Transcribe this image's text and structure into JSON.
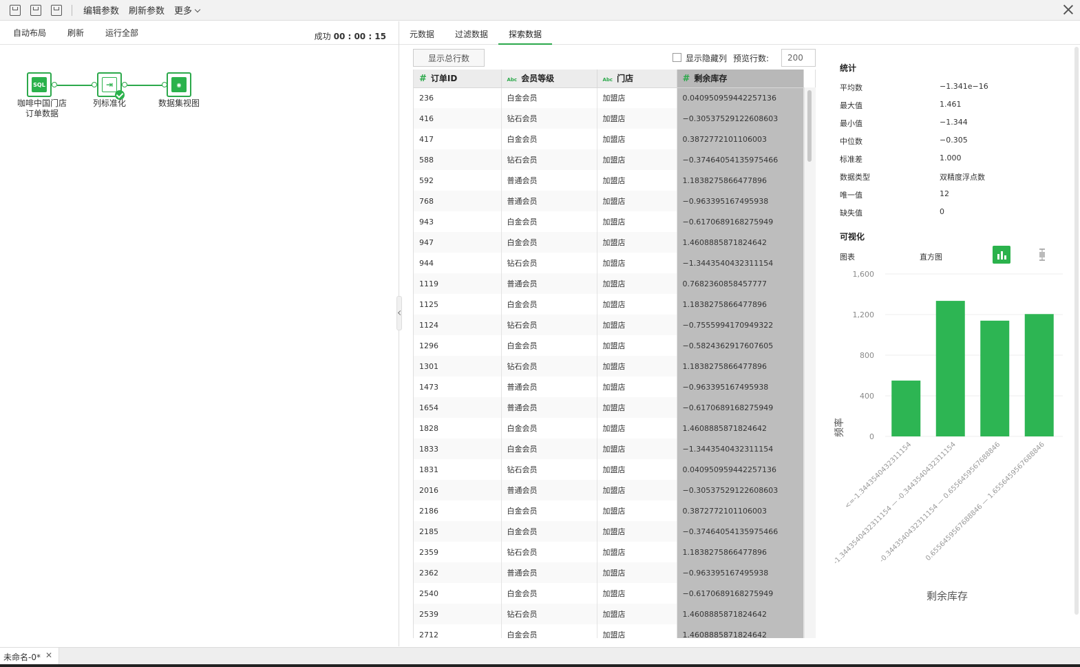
{
  "toolbar": {
    "edit_params": "编辑参数",
    "refresh_params": "刷新参数",
    "more": "更多"
  },
  "left_bar": {
    "auto_layout": "自动布局",
    "refresh": "刷新",
    "run_all": "运行全部",
    "status_label": "成功",
    "status_time": "00 : 00 : 15"
  },
  "flow": {
    "node1_icon": "SQL",
    "node1_line1": "咖啡中国门店",
    "node1_line2": "订单数据",
    "node2_label": "列标准化",
    "node3_label": "数据集视图"
  },
  "tabs": [
    "元数据",
    "过滤数据",
    "探索数据"
  ],
  "table_toolbar": {
    "show_total": "显示总行数",
    "show_hidden": "显示隐藏列",
    "preview_rows_label": "预览行数:",
    "preview_rows_value": "200"
  },
  "table": {
    "columns": [
      {
        "type": "#",
        "name": "订单ID"
      },
      {
        "type": "Abc",
        "name": "会员等级"
      },
      {
        "type": "Abc",
        "name": "门店"
      },
      {
        "type": "#",
        "name": "剩余库存"
      }
    ],
    "rows": [
      [
        "236",
        "白金会员",
        "加盟店",
        "0.040950959442257136"
      ],
      [
        "416",
        "钻石会员",
        "加盟店",
        "−0.30537529122608603"
      ],
      [
        "417",
        "白金会员",
        "加盟店",
        "0.3872772101106003"
      ],
      [
        "588",
        "钻石会员",
        "加盟店",
        "−0.37464054135975466"
      ],
      [
        "592",
        "普通会员",
        "加盟店",
        "1.1838275866477896"
      ],
      [
        "768",
        "普通会员",
        "加盟店",
        "−0.963395167495938"
      ],
      [
        "943",
        "白金会员",
        "加盟店",
        "−0.6170689168275949"
      ],
      [
        "947",
        "白金会员",
        "加盟店",
        "1.4608885871824642"
      ],
      [
        "944",
        "钻石会员",
        "加盟店",
        "−1.3443540432311154"
      ],
      [
        "1119",
        "普通会员",
        "加盟店",
        "0.7682360858457777"
      ],
      [
        "1125",
        "白金会员",
        "加盟店",
        "1.1838275866477896"
      ],
      [
        "1124",
        "钻石会员",
        "加盟店",
        "−0.7555994170949322"
      ],
      [
        "1296",
        "白金会员",
        "加盟店",
        "−0.5824362917607605"
      ],
      [
        "1301",
        "钻石会员",
        "加盟店",
        "1.1838275866477896"
      ],
      [
        "1473",
        "普通会员",
        "加盟店",
        "−0.963395167495938"
      ],
      [
        "1654",
        "普通会员",
        "加盟店",
        "−0.6170689168275949"
      ],
      [
        "1828",
        "白金会员",
        "加盟店",
        "1.4608885871824642"
      ],
      [
        "1833",
        "白金会员",
        "加盟店",
        "−1.3443540432311154"
      ],
      [
        "1831",
        "钻石会员",
        "加盟店",
        "0.040950959442257136"
      ],
      [
        "2016",
        "普通会员",
        "加盟店",
        "−0.30537529122608603"
      ],
      [
        "2186",
        "白金会员",
        "加盟店",
        "0.3872772101106003"
      ],
      [
        "2185",
        "白金会员",
        "加盟店",
        "−0.37464054135975466"
      ],
      [
        "2359",
        "钻石会员",
        "加盟店",
        "1.1838275866477896"
      ],
      [
        "2362",
        "普通会员",
        "加盟店",
        "−0.963395167495938"
      ],
      [
        "2540",
        "白金会员",
        "加盟店",
        "−0.6170689168275949"
      ],
      [
        "2539",
        "钻石会员",
        "加盟店",
        "1.4608885871824642"
      ],
      [
        "2712",
        "白金会员",
        "加盟店",
        "1.4608885871824642"
      ]
    ]
  },
  "stats": {
    "title": "统计",
    "items": [
      {
        "label": "平均数",
        "value": "−1.341e−16"
      },
      {
        "label": "最大值",
        "value": "1.461"
      },
      {
        "label": "最小值",
        "value": "−1.344"
      },
      {
        "label": "中位数",
        "value": "−0.305"
      },
      {
        "label": "标准差",
        "value": "1.000"
      },
      {
        "label": "数据类型",
        "value": "双精度浮点数"
      },
      {
        "label": "唯一值",
        "value": "12"
      },
      {
        "label": "缺失值",
        "value": "0"
      }
    ],
    "viz_title": "可视化",
    "chart_label": "图表",
    "chart_type": "直方图"
  },
  "chart_data": {
    "type": "bar",
    "categories": [
      "<=-1.3443540432311154",
      "-1.3443540432311154 — -0.3443540432311154",
      "-0.3443540432311154 — 0.6556459567688846",
      "0.6556459567688846 — 1.6556459567688846"
    ],
    "values": [
      550,
      1335,
      1140,
      1205
    ],
    "ylim": [
      0,
      1600
    ],
    "yticks": [
      "1,600",
      "1,200",
      "800",
      "400",
      "0"
    ],
    "ylabel": "频率",
    "xlabel": "剩余库存",
    "color": "#2db553",
    "grid": true
  },
  "colors": {
    "accent": "#2ba84a",
    "selected_column": "#bdbdbd"
  },
  "bottom": {
    "file_tab": "未命名-0*",
    "file_tab_close": "✕"
  }
}
